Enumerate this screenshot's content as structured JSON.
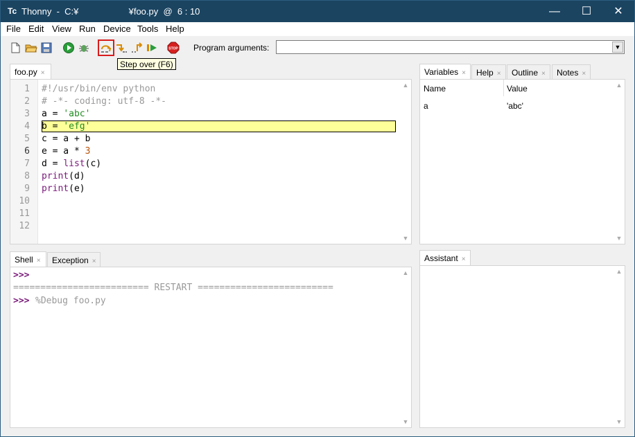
{
  "window": {
    "app_icon": "Tc",
    "title": "Thonny  -  C:¥                    ¥foo.py  @  6 : 10",
    "minimize": "—",
    "maximize": "☐",
    "close": "✕"
  },
  "menu": [
    "File",
    "Edit",
    "View",
    "Run",
    "Device",
    "Tools",
    "Help"
  ],
  "toolbar": {
    "icons": [
      "new-file-icon",
      "open-file-icon",
      "save-icon",
      "run-icon",
      "debug-icon",
      "step-over-icon",
      "step-into-icon",
      "step-out-icon",
      "resume-icon",
      "stop-icon"
    ],
    "stop_label": "STOP",
    "program_arguments_label": "Program arguments:",
    "program_arguments_value": "",
    "dropdown_glyph": "▼"
  },
  "tooltip": "Step over (F6)",
  "editor": {
    "tab": "foo.py",
    "line_numbers": [
      "1",
      "2",
      "3",
      "4",
      "5",
      "6",
      "7",
      "8",
      "9",
      "10",
      "11",
      "12"
    ],
    "lines": [
      {
        "parts": [
          {
            "t": "#!/usr/bin/env python",
            "c": "comment"
          }
        ]
      },
      {
        "parts": [
          {
            "t": "# -*- coding: utf-8 -*-",
            "c": "comment"
          }
        ]
      },
      {
        "parts": [
          {
            "t": "a = ",
            "c": ""
          },
          {
            "t": "'abc'",
            "c": "str"
          }
        ]
      },
      {
        "parts": [
          {
            "t": "b = ",
            "c": ""
          },
          {
            "t": "'efg'",
            "c": "str"
          }
        ]
      },
      {
        "parts": [
          {
            "t": "c = a + b",
            "c": ""
          }
        ]
      },
      {
        "parts": [
          {
            "t": "e = a * ",
            "c": ""
          },
          {
            "t": "3",
            "c": "num"
          }
        ]
      },
      {
        "parts": [
          {
            "t": "d = ",
            "c": ""
          },
          {
            "t": "list",
            "c": "builtin"
          },
          {
            "t": "(c)",
            "c": ""
          }
        ]
      },
      {
        "parts": [
          {
            "t": "print",
            "c": "builtin"
          },
          {
            "t": "(d)",
            "c": ""
          }
        ]
      },
      {
        "parts": [
          {
            "t": "print",
            "c": "builtin"
          },
          {
            "t": "(e)",
            "c": ""
          }
        ]
      }
    ],
    "highlighted_line": 4
  },
  "right_tabs": [
    "Variables",
    "Help",
    "Outline",
    "Notes"
  ],
  "variables": {
    "col_name": "Name",
    "col_value": "Value",
    "rows": [
      {
        "name": "a",
        "value": "'abc'"
      }
    ]
  },
  "bottom_tabs": [
    "Shell",
    "Exception"
  ],
  "shell": {
    "prompt": ">>>",
    "restart_line": "========================= RESTART =========================",
    "command": "%Debug foo.py"
  },
  "assistant_tab": "Assistant",
  "tab_close_glyph": "×",
  "scroll_up": "▲",
  "scroll_down": "▼"
}
